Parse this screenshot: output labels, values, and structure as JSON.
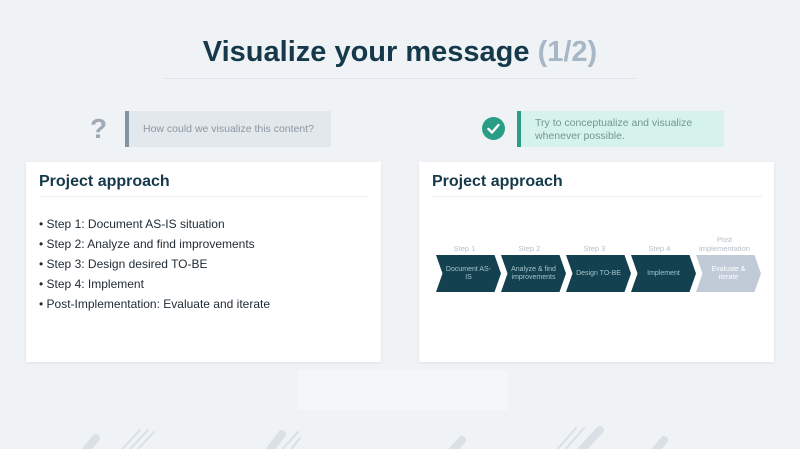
{
  "header": {
    "title": "Visualize your message",
    "subtitle": "(1/2)"
  },
  "hints": {
    "question_icon": "question-mark-icon",
    "question_text": "How could we visualize this content?",
    "check_icon": "check-circle-icon",
    "answer_text": "Try to conceptualize and visualize whenever possible."
  },
  "left_card": {
    "title": "Project approach",
    "items": [
      "Step 1: Document AS-IS situation",
      "Step 2: Analyze and find improvements",
      "Step 3: Design desired TO-BE",
      "Step 4: Implement",
      "Post-Implementation: Evaluate and iterate"
    ]
  },
  "right_card": {
    "title": "Project approach",
    "steps": [
      {
        "label": "Step 1",
        "text": "Document AS-IS",
        "style": "dark"
      },
      {
        "label": "Step 2",
        "text": "Analyze & find improvements",
        "style": "dark"
      },
      {
        "label": "Step 3",
        "text": "Design TO-BE",
        "style": "dark"
      },
      {
        "label": "Step 4",
        "text": "Implement",
        "style": "dark"
      },
      {
        "label": "Post implementation",
        "text": "Evaluate & iterate",
        "style": "light"
      }
    ]
  },
  "colors": {
    "title": "#15394a",
    "subtitle": "#a7b7c6",
    "accent_green": "#2a9d86",
    "arrow_dark": "#14414f",
    "arrow_light": "#c1cbd8"
  }
}
